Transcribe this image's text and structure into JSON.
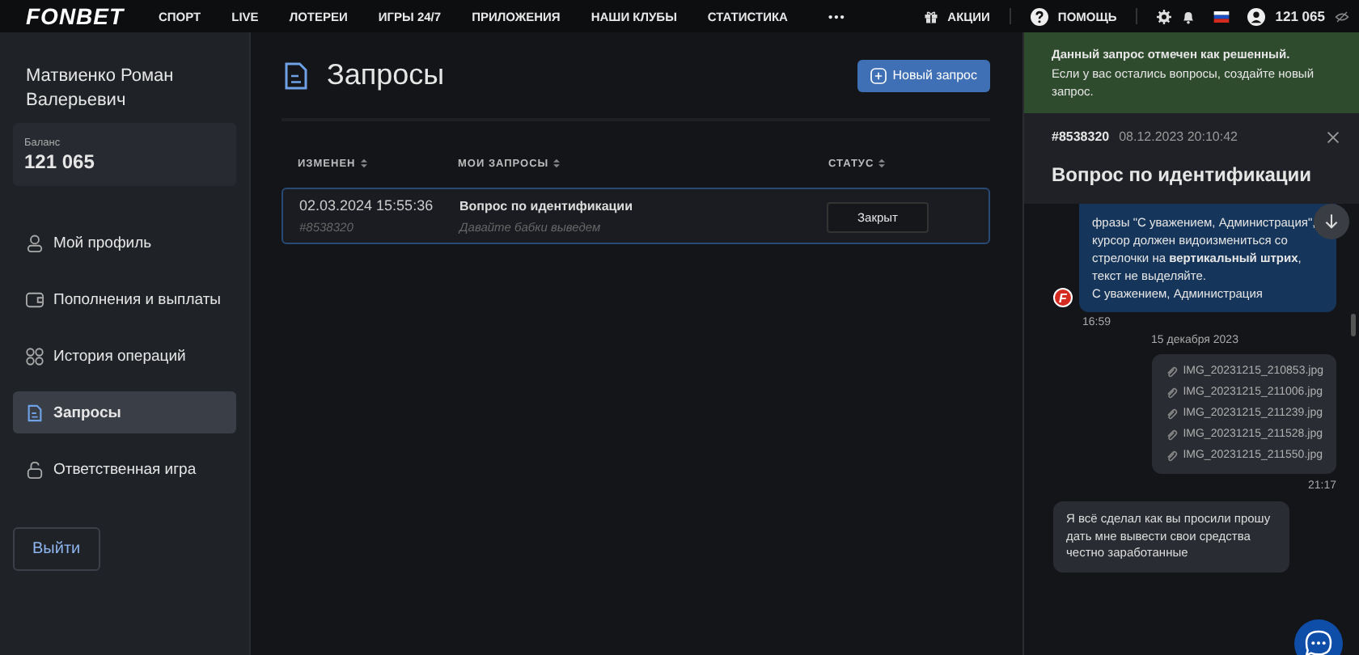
{
  "topbar": {
    "logo": "FONBET",
    "nav": [
      "СПОРТ",
      "LIVE",
      "ЛОТЕРЕИ",
      "ИГРЫ 24/7",
      "ПРИЛОЖЕНИЯ",
      "НАШИ КЛУБЫ",
      "СТАТИСТИКА"
    ],
    "more": "•••",
    "promo": "АКЦИИ",
    "help": "ПОМОЩЬ",
    "balance": "121 065"
  },
  "sidebar": {
    "user_name": "Матвиенко Роман Валерьевич",
    "balance_label": "Баланс",
    "balance": "121 065",
    "items": [
      {
        "label": "Мой профиль",
        "selected": false
      },
      {
        "label": "Пополнения и выплаты",
        "selected": false
      },
      {
        "label": "История операций",
        "selected": false
      },
      {
        "label": "Запросы",
        "selected": true
      },
      {
        "label": "Ответственная игра",
        "selected": false
      }
    ],
    "logout": "Выйти"
  },
  "main": {
    "title": "Запросы",
    "new_button": "Новый запрос",
    "table": {
      "columns": [
        "ИЗМЕНЕН",
        "МОИ ЗАПРОСЫ",
        "СТАТУС"
      ],
      "rows": [
        {
          "date": "02.03.2024 15:55:36",
          "id": "#8538320",
          "subject": "Вопрос по идентификации",
          "preview": "Давайте бабки выведем",
          "status": "Закрыт"
        }
      ]
    }
  },
  "panel": {
    "notice": {
      "title": "Данный запрос отмечен как решенный.",
      "text": "Если у вас остались вопросы, создайте новый запрос."
    },
    "ticket": {
      "id": "#8538320",
      "datetime": "08.12.2023 20:10:42",
      "title": "Вопрос по идентификации"
    },
    "messages": [
      {
        "kind": "admin",
        "paragraphs": [
          "фразы \"С уважением, Администрация\", курсор должен видоизмениться со стрелочки на **вертикальный штрих**, текст не выделяйте.",
          "С уважением, Администрация"
        ],
        "avatar": "F",
        "time": "16:59"
      },
      {
        "kind": "date",
        "text": "15 декабря 2023"
      },
      {
        "kind": "files",
        "files": [
          "IMG_20231215_210853.jpg",
          "IMG_20231215_211006.jpg",
          "IMG_20231215_211239.jpg",
          "IMG_20231215_211528.jpg",
          "IMG_20231215_211550.jpg"
        ],
        "time": "21:17"
      },
      {
        "kind": "user",
        "text": "Я всё сделал как вы просили прошу дать мне вывести свои средства честно заработанные"
      }
    ]
  }
}
